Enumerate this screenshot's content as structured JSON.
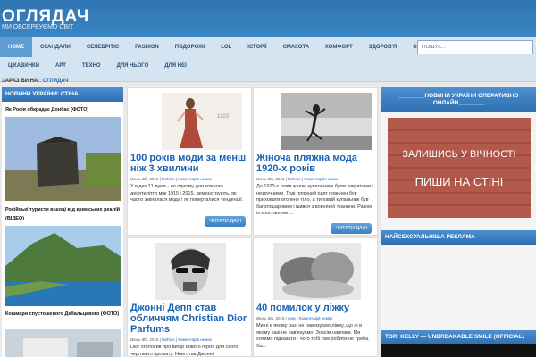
{
  "site": {
    "title": "ОГЛЯДАЧ",
    "description": "МИ ОБСЕРВУЄМО СВІТ"
  },
  "nav": {
    "row1": [
      "HOME",
      "СКАНДАЛИ",
      "СЕЛЕБРІТІС",
      "FASHION",
      "ПОДОРОЖІ",
      "LOL",
      "ІСТОРІЇ",
      "СМАКОТА",
      "КОМФОРТ",
      "ЗДОРОВ'Я",
      "СЕКС"
    ],
    "row2": [
      "ЦІКАВИНКИ",
      "АРТ",
      "ТЕХНО",
      "ДЛЯ НЬОГО",
      "ДЛЯ НЕЇ"
    ],
    "search_placeholder": "ПОШУК..."
  },
  "breadcrumb": {
    "label": "ЗАРАЗ ВИ НА :",
    "current": "ОГЛЯДАЧ"
  },
  "left_sidebar": {
    "title": "НОВИНИ УКРАЇНИ: СТІНА",
    "items": [
      "Як Росія обкрадає Донбас (ФОТО)",
      "Російські туристи в шоці від кримських реалій (ВІДЕО)",
      "Кошмари спустошеного Дебальцевого (ФОТО)"
    ]
  },
  "posts": [
    {
      "title": "100 років моди за менш ніж 3 хвилини",
      "date": "Июнь 6th, 2015",
      "category": "fashion",
      "comments": "Коментарів немає",
      "excerpt": "У відео 11 луків - по одному для кожного десятиліття між 1915 і 2015, демонструють, як часто змінялася мода і як поверталися тенденції.",
      "button": "ЧИТАТИ ДАЛІ",
      "image_label": "1923"
    },
    {
      "title": "Жіноча пляжна мода 1920-х років",
      "date": "Июнь 6th, 2015",
      "category": "fashion",
      "comments": "Коментарів немає",
      "excerpt": "До 1920-х років жіночі купальники були закритими і незручними. Тоді пляжний одяг повинен був приховати оголене тіло, а типовий купальник був багатошаровим і шився з вовняної тканини. Разом із зростанням ...",
      "button": "ЧИТАТИ ДАЛІ"
    },
    {
      "title": "Джонні Депп став обличчям Christian Dior Parfums",
      "date": "Июнь 6th, 2015",
      "category": "fashion",
      "comments": "Коментарів немає",
      "excerpt": "Dior оголосив про вибір нового героя для свого чергового аромату. Ним став Джонні"
    },
    {
      "title": "40 помилок у ліжку",
      "date": "Июнь 6th, 2015",
      "category": "секс",
      "comments": "Коментарів немає",
      "excerpt": "Ми ні в якому разі не нав'язуємо ліжку, що ні в якому разі не нав'язуємо. Зовсім навпаки. Ми хочемо підказати - чого тобі там робити не треба. Ха..."
    }
  ],
  "right_sidebar": {
    "widget1_title": "________НОВИНИ УКРАЇНИ ОПЕРАТИВНО ОНЛАЙН________",
    "wall_line1": "ЗАЛИШИСЬ У ВІЧНОСТІ",
    "wall_line2": "ПИШИ НА СТІНІ",
    "widget2_title": "НАЙСЕКСУАЛЬНІША РЕКЛАМА",
    "widget3_title": "TORI KELLY — UNBREAKABLE SMILE (OFFICIAL)"
  },
  "colors": {
    "header": "#2f74b3",
    "nav": "#d5e4f1",
    "link": "#1a62b5",
    "accent": "#5f9cd2"
  }
}
